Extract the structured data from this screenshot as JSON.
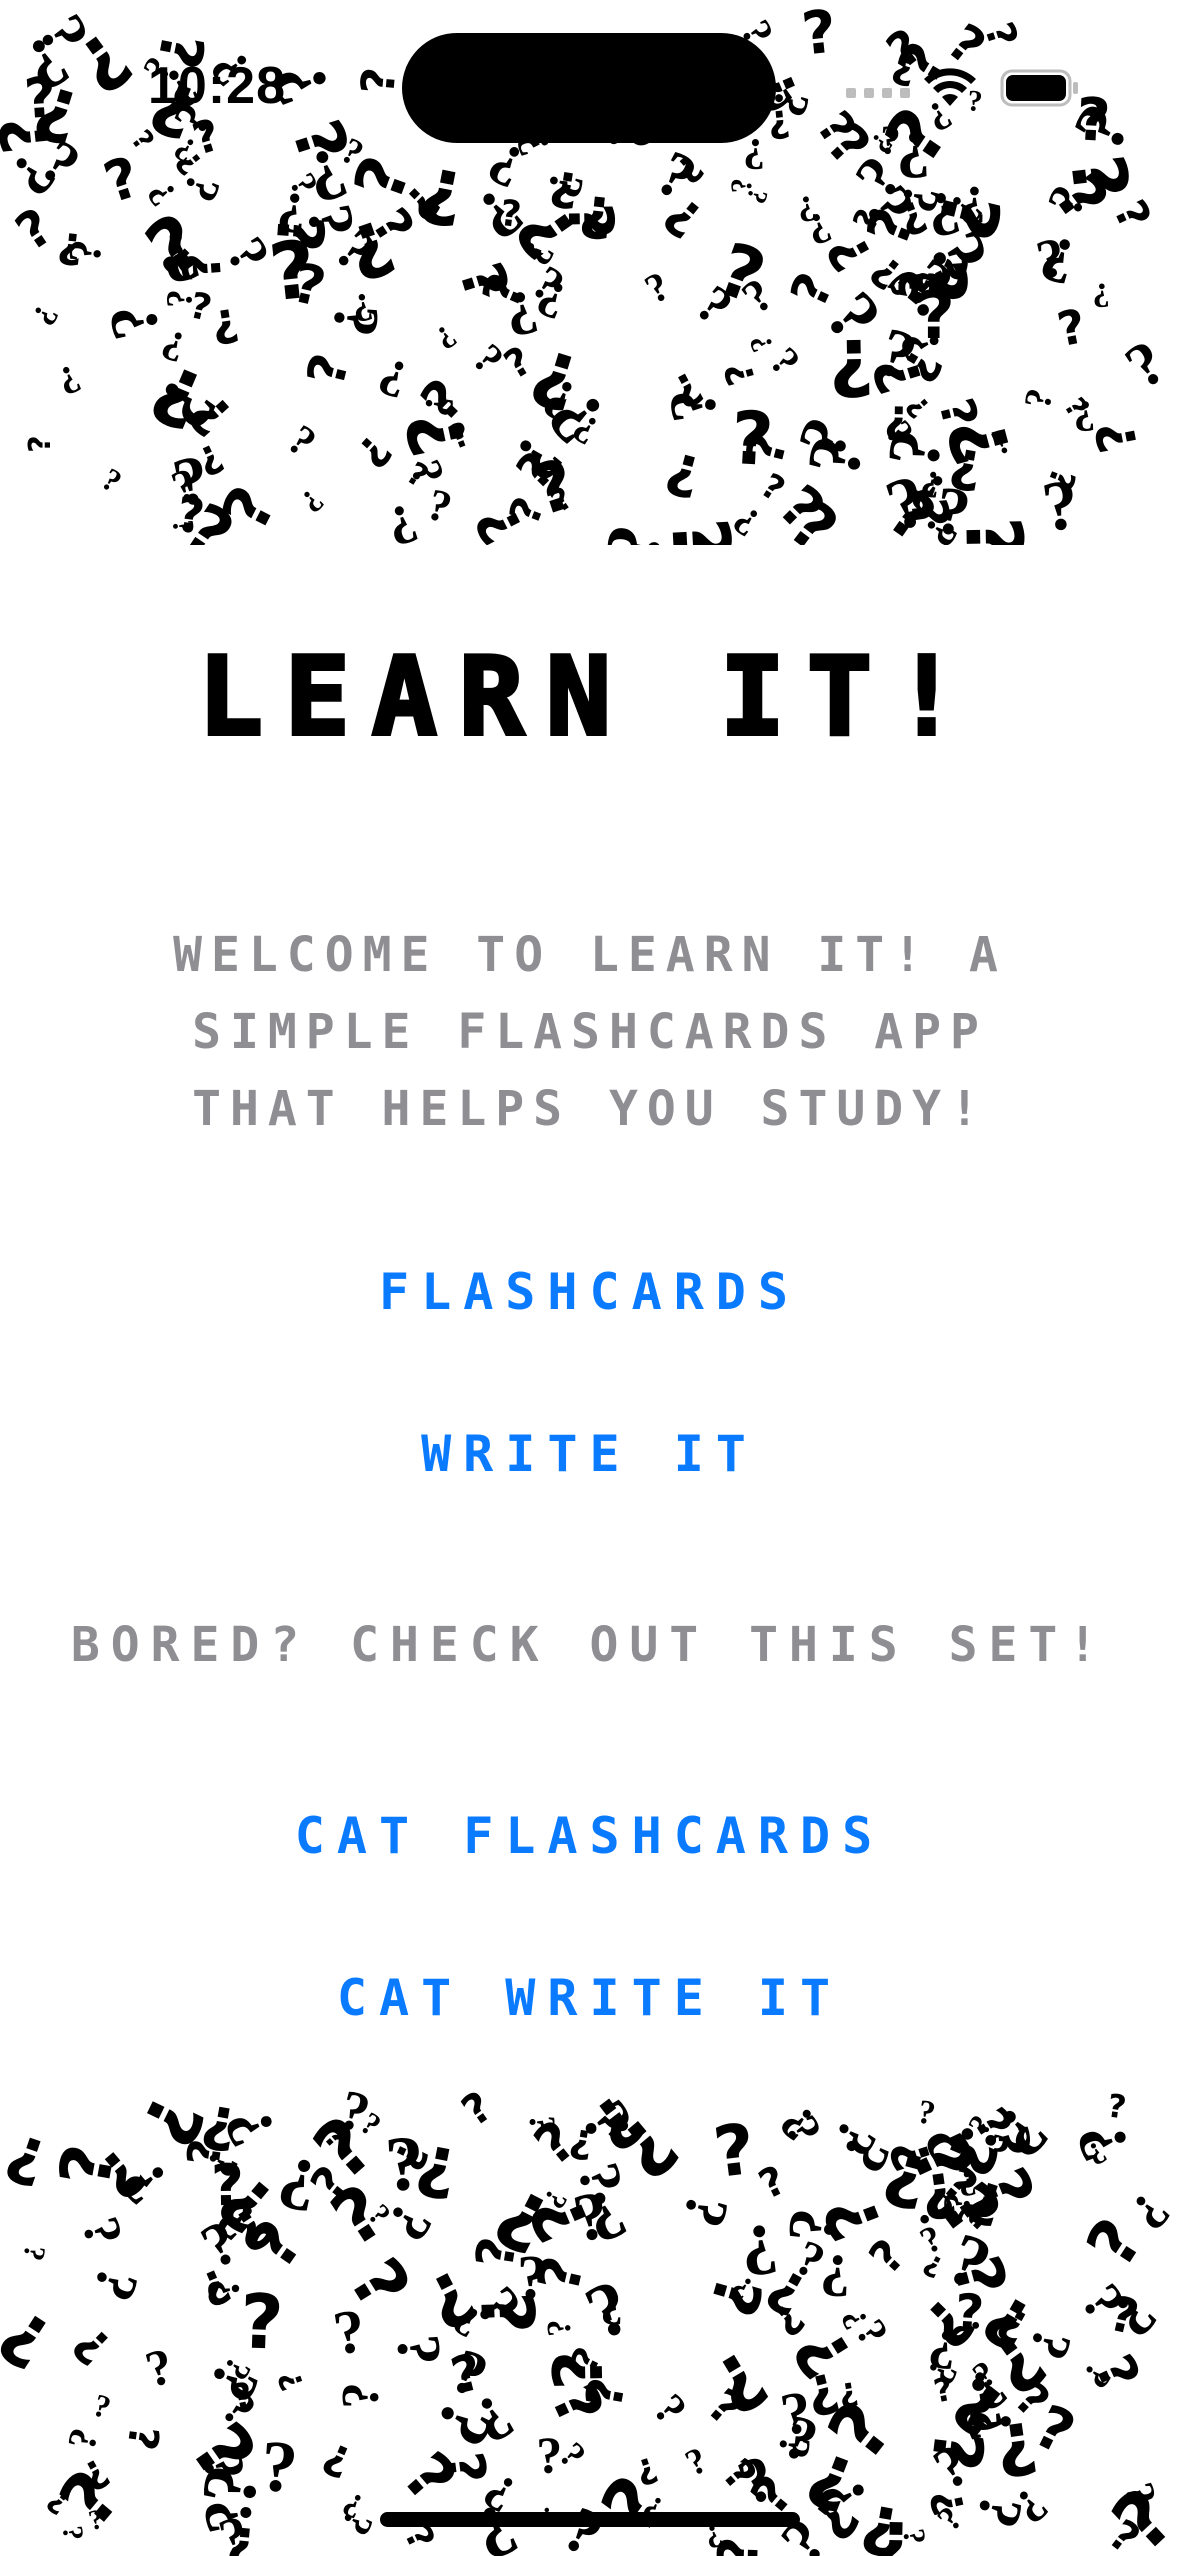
{
  "status_bar": {
    "time": "10:28"
  },
  "header": {
    "title": "LEARN IT!"
  },
  "main": {
    "welcome_text": "WELCOME TO LEARN IT! A SIMPLE FLASHCARDS APP THAT HELPS YOU STUDY!",
    "buttons": {
      "flashcards": "FLASHCARDS",
      "write_it": "WRITE IT"
    },
    "bored_text": "BORED? CHECK OUT THIS SET!",
    "cat_buttons": {
      "cat_flashcards": "CAT FLASHCARDS",
      "cat_write_it": "CAT WRITE IT"
    }
  },
  "colors": {
    "accent": "#0A7AFF",
    "secondary_text": "#8E8E93",
    "title": "#000000",
    "background": "#FFFFFF"
  },
  "icons": {
    "background_pattern": "question-mark-pattern",
    "status": [
      "cellular-signal-icon",
      "wifi-icon",
      "battery-icon"
    ]
  }
}
